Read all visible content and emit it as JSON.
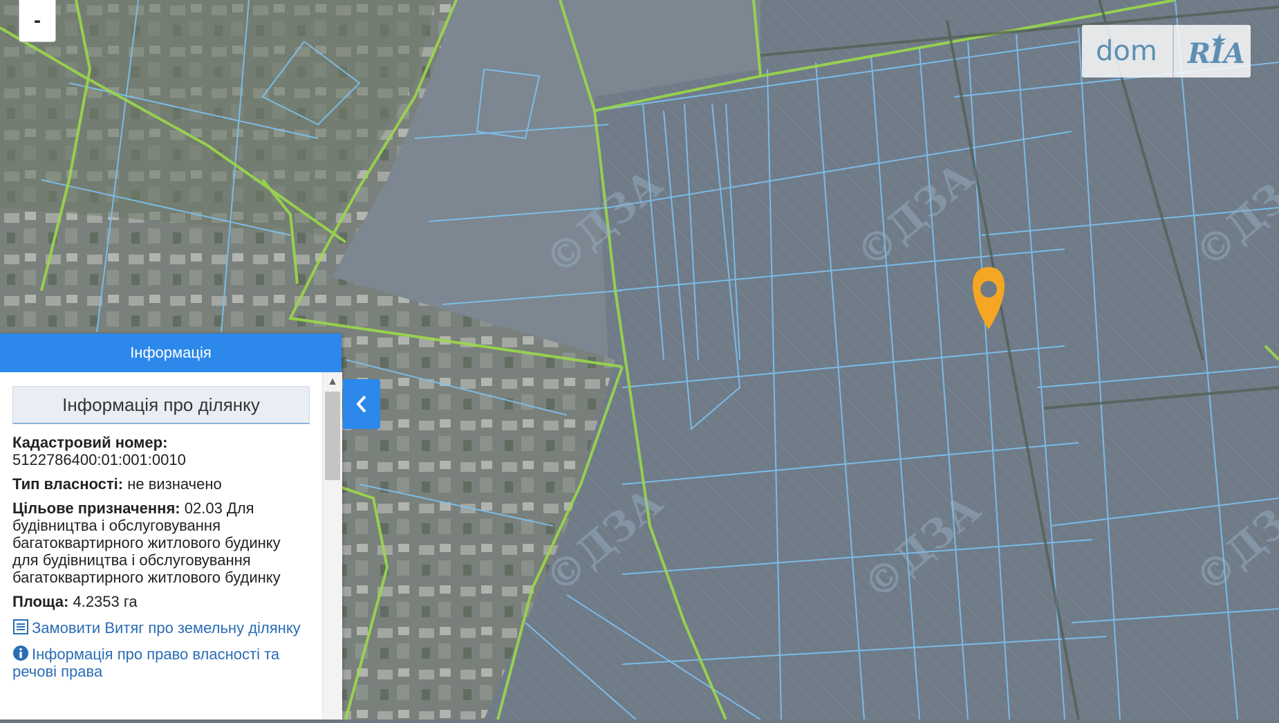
{
  "map": {
    "zoom_out_label": "-",
    "watermark_text": "ДЗА",
    "accent_colors": {
      "parcel_lines": "#7cc3f2",
      "boundary_lines": "#9ad94a",
      "marker": "#f5a623",
      "panel_header": "#2c88ea"
    }
  },
  "logo": {
    "dom": "dom",
    "ria": "RIA"
  },
  "panel": {
    "header": "Інформація",
    "section_title": "Інформація про ділянку",
    "cadastral_label": "Кадастровий номер:",
    "cadastral_value": "5122786400:01:001:0010",
    "ownership_label": "Тип власності:",
    "ownership_value": "не визначено",
    "purpose_label": "Цільове призначення:",
    "purpose_value": "02.03 Для будівництва і обслуговування багатоквартирного житлового будинку для будівництва і обслуговування багатоквартирного житлового будинку",
    "area_label": "Площа:",
    "area_value": "4.2353 га",
    "link_extract": "Замовити Витяг про земельну ділянку",
    "link_rights": "Інформація про право власності та речові права"
  },
  "icons": {
    "zoom": "minus-icon",
    "toggle": "chevron-left-icon",
    "marker": "location-pin-icon",
    "extract": "document-list-icon",
    "rights": "info-circle-icon"
  }
}
